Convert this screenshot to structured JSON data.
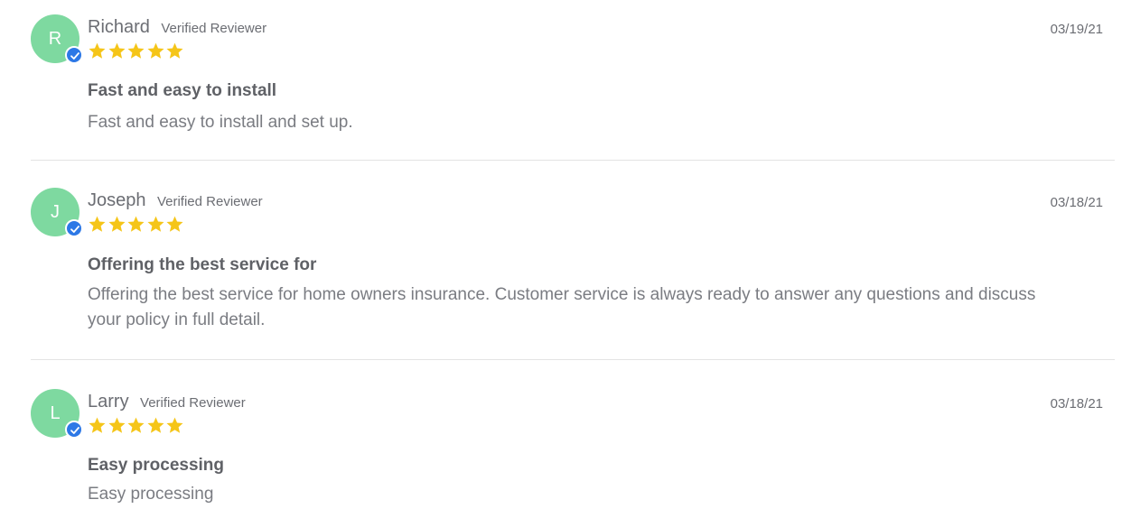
{
  "theme": {
    "avatar_color": "#7ed9a0",
    "check_color": "#2d78e6",
    "star_color": "#f5c518",
    "text_color": "#6b6d73"
  },
  "reviews": [
    {
      "initial": "R",
      "name": "Richard",
      "badge": "Verified Reviewer",
      "rating": 5,
      "date": "03/19/21",
      "title": "Fast and easy to install",
      "body": "Fast and easy to install and set up."
    },
    {
      "initial": "J",
      "name": "Joseph",
      "badge": "Verified Reviewer",
      "rating": 5,
      "date": "03/18/21",
      "title": "Offering the best service for",
      "body": "Offering the best service for home owners insurance. Customer service is always ready to answer any questions and discuss your policy in full detail."
    },
    {
      "initial": "L",
      "name": "Larry",
      "badge": "Verified Reviewer",
      "rating": 5,
      "date": "03/18/21",
      "title": "Easy processing",
      "body": "Easy processing"
    }
  ]
}
